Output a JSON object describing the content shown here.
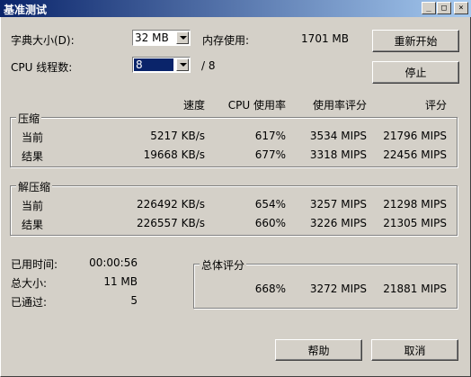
{
  "window": {
    "title": "基准测试"
  },
  "titlebar_buttons": [
    "_",
    "□",
    "×"
  ],
  "dict_size": {
    "label": "字典大小(D):",
    "value": "32 MB"
  },
  "memory": {
    "label": "内存使用:",
    "value": "1701 MB"
  },
  "threads": {
    "label": "CPU 线程数:",
    "value": "8",
    "max": "/ 8"
  },
  "buttons": {
    "restart": "重新开始",
    "stop": "停止",
    "help": "帮助",
    "cancel": "取消"
  },
  "columns": {
    "speed": "速度",
    "cpu_usage": "CPU 使用率",
    "usage_rating": "使用率评分",
    "rating": "评分"
  },
  "compression": {
    "title": "压缩",
    "rows": [
      {
        "label": "当前",
        "speed": "5217 KB/s",
        "cpu": "617%",
        "usage_rating": "3534 MIPS",
        "rating": "21796 MIPS"
      },
      {
        "label": "结果",
        "speed": "19668 KB/s",
        "cpu": "677%",
        "usage_rating": "3318 MIPS",
        "rating": "22456 MIPS"
      }
    ]
  },
  "decompression": {
    "title": "解压缩",
    "rows": [
      {
        "label": "当前",
        "speed": "226492 KB/s",
        "cpu": "654%",
        "usage_rating": "3257 MIPS",
        "rating": "21298 MIPS"
      },
      {
        "label": "结果",
        "speed": "226557 KB/s",
        "cpu": "660%",
        "usage_rating": "3226 MIPS",
        "rating": "21305 MIPS"
      }
    ]
  },
  "stats": [
    {
      "label": "已用时间:",
      "value": "00:00:56"
    },
    {
      "label": "总大小:",
      "value": "11 MB"
    },
    {
      "label": "已通过:",
      "value": "5"
    }
  ],
  "total": {
    "title": "总体评分",
    "cpu": "668%",
    "usage_rating": "3272 MIPS",
    "rating": "21881 MIPS"
  }
}
